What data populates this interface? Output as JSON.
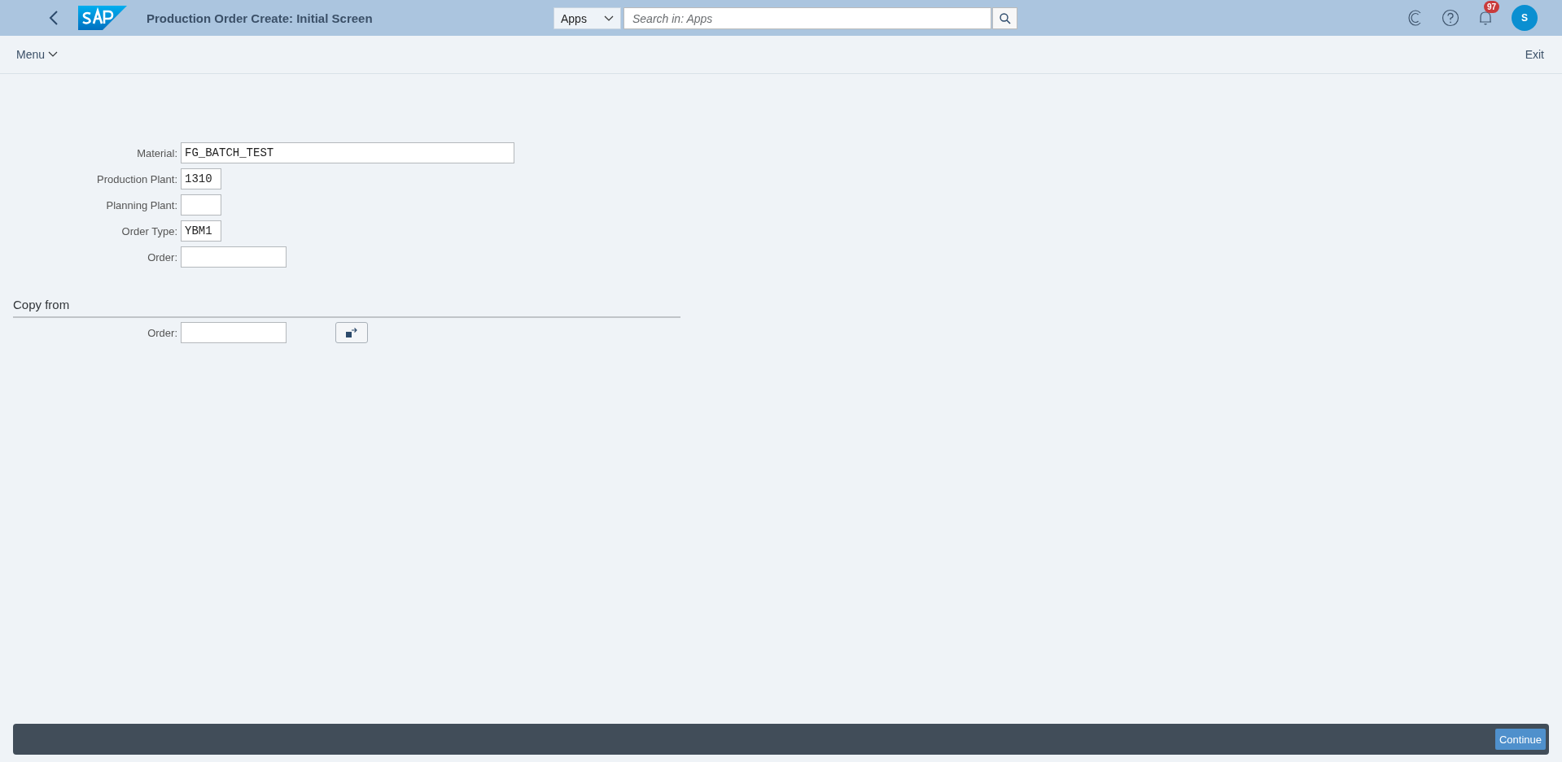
{
  "shell_bar": {
    "title": "Production Order Create: Initial Screen",
    "search_scope": "Apps",
    "search": {
      "placeholder": "Search in: Apps"
    },
    "notifications": {
      "count": "97"
    },
    "avatar": {
      "initial": "S"
    }
  },
  "toolbar": {
    "menu": "Menu",
    "exit": "Exit"
  },
  "fields": [
    {
      "label": "Material:",
      "value": "FG_BATCH_TEST",
      "kind": "long"
    },
    {
      "label": "Production Plant:",
      "value": "1310",
      "kind": "short"
    },
    {
      "label": "Planning Plant:",
      "kind": "short"
    },
    {
      "label": "Order Type:",
      "value": "YBM1",
      "kind": "short"
    },
    {
      "label": "Order:",
      "kind": "medium"
    }
  ],
  "copy_from": {
    "title": "Copy from",
    "fields": [
      {
        "label": "Order:",
        "kind": "medium"
      }
    ]
  },
  "footer": {
    "buttons": [
      "Continue"
    ]
  }
}
